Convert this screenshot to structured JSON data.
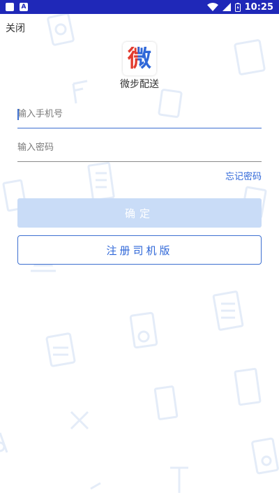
{
  "status_bar": {
    "time": "10:25",
    "notification_icon": "A",
    "icons": [
      "app-square-icon",
      "notification-a-icon",
      "wifi-icon",
      "signal-icon",
      "battery-icon"
    ],
    "color": "#1f28b8"
  },
  "header": {
    "close_label": "关闭"
  },
  "app": {
    "logo_glyph": "微",
    "name": "微步配送",
    "logo_colors": [
      "#e23b2e",
      "#2f67d8"
    ]
  },
  "form": {
    "phone_placeholder": "输入手机号",
    "phone_value": "",
    "password_placeholder": "输入密码",
    "password_value": "",
    "forgot_label": "忘记密码",
    "confirm_label": "确定",
    "register_label": "注册司机版"
  },
  "colors": {
    "accent": "#2f67d8",
    "confirm_disabled": "#c9dcf7",
    "pattern": "#e4ecf8"
  }
}
